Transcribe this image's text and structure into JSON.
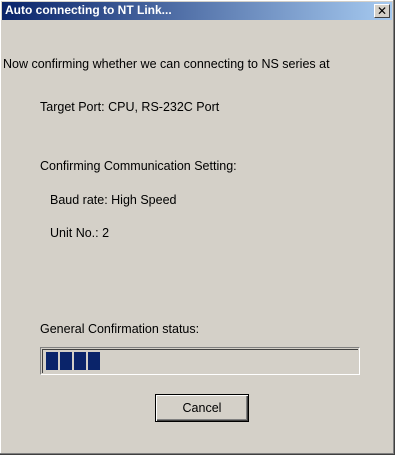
{
  "window": {
    "title": "Auto connecting to NT Link...",
    "close_glyph": "✕"
  },
  "dialog": {
    "intro": "Now confirming whether we can connecting to NS series at",
    "target_port": "Target Port: CPU, RS-232C Port",
    "confirming_label": "Confirming Communication Setting:",
    "baud_rate": "Baud rate: High Speed",
    "unit_no": "Unit No.: 2",
    "general_status_label": "General Confirmation status:",
    "progress": {
      "filled_segments": 4,
      "fraction": 0.13
    },
    "cancel_label": "Cancel"
  },
  "colors": {
    "titlebar_start": "#0a246a",
    "titlebar_end": "#a6caf0",
    "window_face": "#d4d0c8",
    "progress_fill": "#0a246a"
  }
}
